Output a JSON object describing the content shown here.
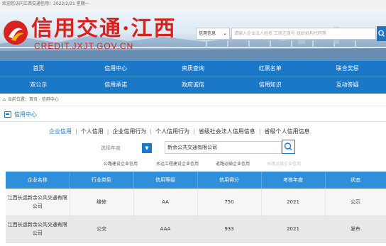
{
  "topbar": {
    "text": "欢迎您访问江西交通信用！2022/2/21 星期一"
  },
  "logo": {
    "title_cn": "信用交通·江西",
    "title_en": "CREDIT.JXJT.GOV.CN"
  },
  "search": {
    "type_label": "信用信息",
    "placeholder": "请输入企业法人姓名 工商注册号 组织机构代码等"
  },
  "nav": {
    "row1": [
      "首页",
      "信用中心",
      "资质查询",
      "红黑名单",
      "联合奖惩"
    ],
    "row2": [
      "双公示",
      "信用承诺",
      "政府诚信",
      "信用知识",
      "互动答疑"
    ]
  },
  "breadcrumb": {
    "text": "当前位置：首页 - 信用中心"
  },
  "section": {
    "title": "信用中心"
  },
  "tabs": [
    {
      "label": "企业信用",
      "active": true
    },
    {
      "label": "个人信用",
      "active": false
    },
    {
      "label": "企业信用行为",
      "active": false
    },
    {
      "label": "个人信用行为",
      "active": false
    },
    {
      "label": "省级社会法人信用信息",
      "active": false
    },
    {
      "label": "省级个人信用信息",
      "active": false
    }
  ],
  "filters": {
    "year_placeholder": "选择年度",
    "company_value": "新余公共交通有限公司"
  },
  "categories": [
    {
      "label": "公路建设企业信用",
      "enabled": true
    },
    {
      "label": "水运工程建设企业信用",
      "enabled": true
    },
    {
      "label": "道路运输企业信用",
      "enabled": true
    },
    {
      "label": "水路运输企业信用",
      "enabled": false
    }
  ],
  "table": {
    "headers": [
      "企业名称",
      "行业类型",
      "信用等级",
      "信用得分",
      "考核年度",
      "状态"
    ],
    "rows": [
      {
        "name": "江西长运新余公共交通有限公司",
        "industry": "维修",
        "grade": "AA",
        "score": "750",
        "year": "2021",
        "status": "公示"
      },
      {
        "name": "江西长运新余公共交通有限公司",
        "industry": "公交",
        "grade": "AAA",
        "score": "933",
        "year": "2021",
        "status": "发布"
      }
    ]
  },
  "colors": {
    "brand_blue": "#1b78c8",
    "logo_red": "#d8221f",
    "table_header": "#2f8fdb"
  }
}
